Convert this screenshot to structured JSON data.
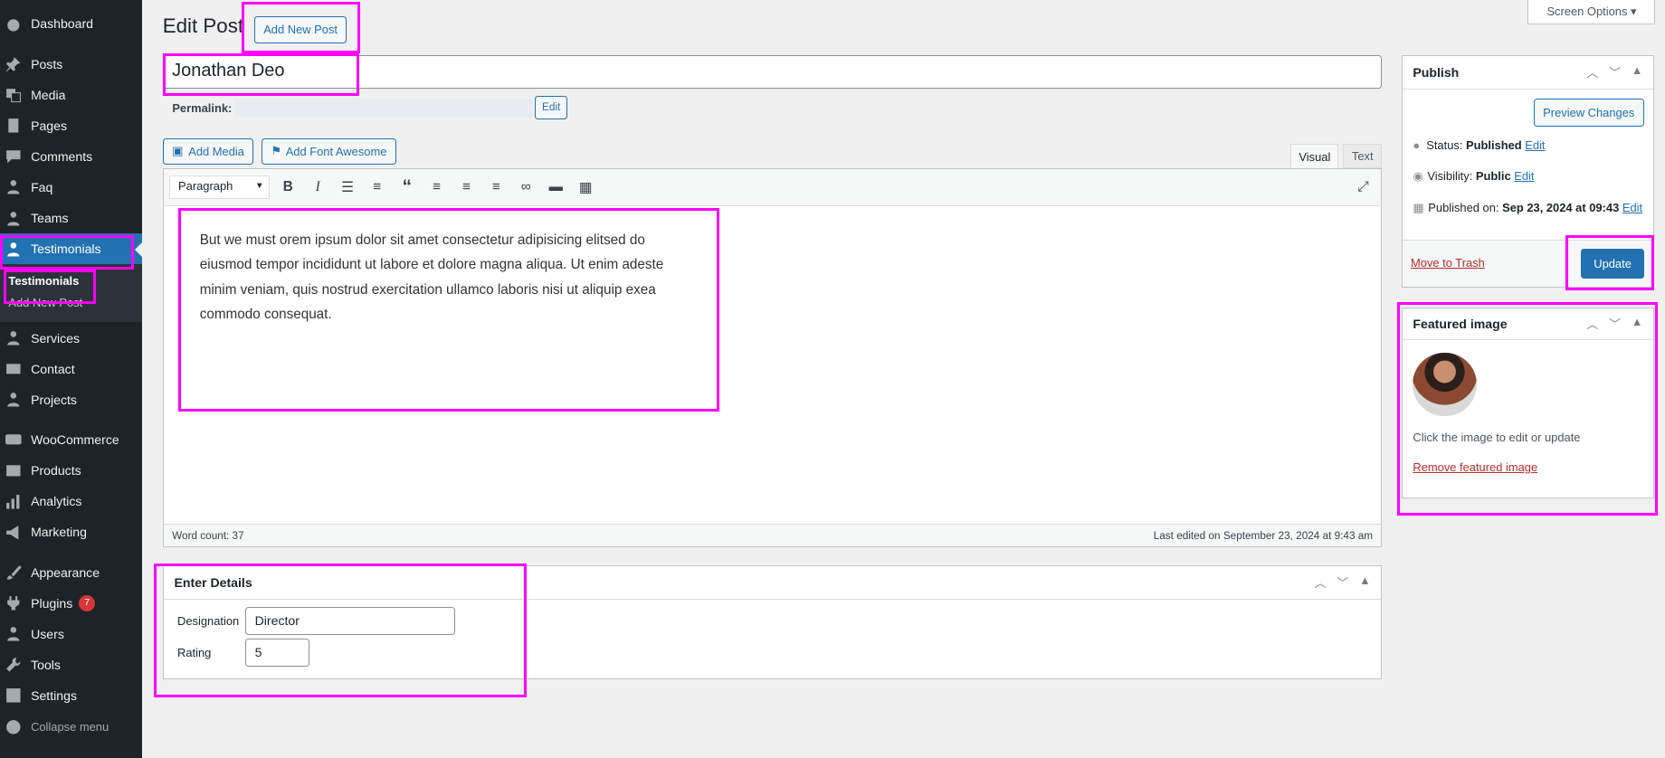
{
  "sidebar": {
    "items": [
      "Dashboard",
      "Posts",
      "Media",
      "Pages",
      "Comments",
      "Faq",
      "Teams",
      "Testimonials",
      "Services",
      "Contact",
      "Projects",
      "WooCommerce",
      "Products",
      "Analytics",
      "Marketing",
      "Appearance",
      "Plugins",
      "Users",
      "Tools",
      "Settings"
    ],
    "submenu": [
      "Testimonials",
      "Add New Post"
    ],
    "plugins_badge": "7",
    "collapse": "Collapse menu"
  },
  "header": {
    "title": "Edit Post",
    "add_new": "Add New Post",
    "screen_options": "Screen Options ▾"
  },
  "post": {
    "title": "Jonathan Deo",
    "permalink_label": "Permalink:",
    "permalink_edit": "Edit"
  },
  "editor": {
    "add_media": "Add Media",
    "add_fa": "Add Font Awesome",
    "tab_visual": "Visual",
    "tab_text": "Text",
    "format": "Paragraph",
    "content": "But we must orem ipsum dolor sit amet consectetur adipisicing elitsed do eiusmod tempor incididunt ut labore et dolore magna aliqua. Ut enim adeste minim veniam, quis nostrud exercitation ullamco laboris nisi ut aliquip exea commodo consequat.",
    "word_count": "Word count: 37",
    "last_edited": "Last edited on September 23, 2024 at 9:43 am"
  },
  "details": {
    "title": "Enter Details",
    "designation_label": "Designation",
    "designation": "Director",
    "rating_label": "Rating",
    "rating": "5"
  },
  "publish": {
    "title": "Publish",
    "preview": "Preview Changes",
    "status_label": "Status:",
    "status": "Published",
    "visibility_label": "Visibility:",
    "visibility": "Public",
    "published_label": "Published on:",
    "published": "Sep 23, 2024 at 09:43",
    "edit": "Edit",
    "trash": "Move to Trash",
    "update": "Update"
  },
  "featured": {
    "title": "Featured image",
    "hint": "Click the image to edit or update",
    "remove": "Remove featured image"
  },
  "colors": {
    "accent": "#2271b1",
    "highlight": "#ff00ff",
    "sidebar": "#1d2327"
  }
}
